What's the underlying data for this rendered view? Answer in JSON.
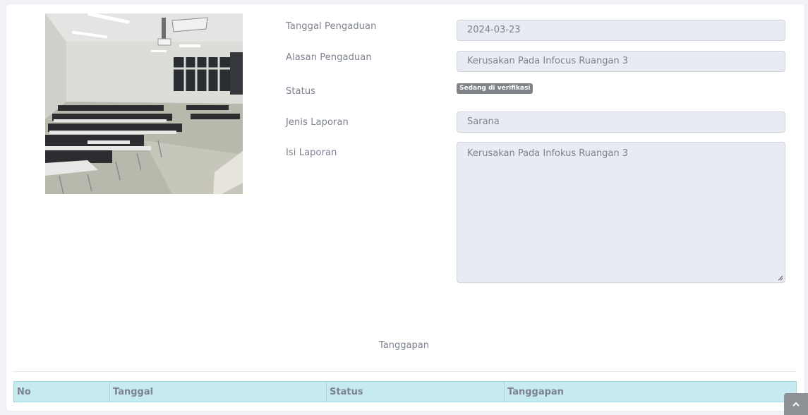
{
  "form": {
    "tanggal_label": "Tanggal Pengaduan",
    "tanggal_value": "2024-03-23",
    "alasan_label": "Alasan Pengaduan",
    "alasan_value": "Kerusakan Pada Infocus Ruangan 3",
    "status_label": "Status",
    "status_badge": "Sedang di verifikasi",
    "jenis_label": "Jenis Laporan",
    "jenis_value": "Sarana",
    "isi_label": "Isi Laporan",
    "isi_value": "Kerusakan Pada Infokus Ruangan 3"
  },
  "response_section": {
    "title": "Tanggapan",
    "columns": [
      "No",
      "Tanggal",
      "Status",
      "Tanggapan"
    ]
  },
  "colors": {
    "badge": "#7f8388",
    "table_header": "#c6eaf0",
    "field_bg": "#e9ebf2"
  },
  "icons": {
    "scroll_top": "chevron-up-icon"
  }
}
